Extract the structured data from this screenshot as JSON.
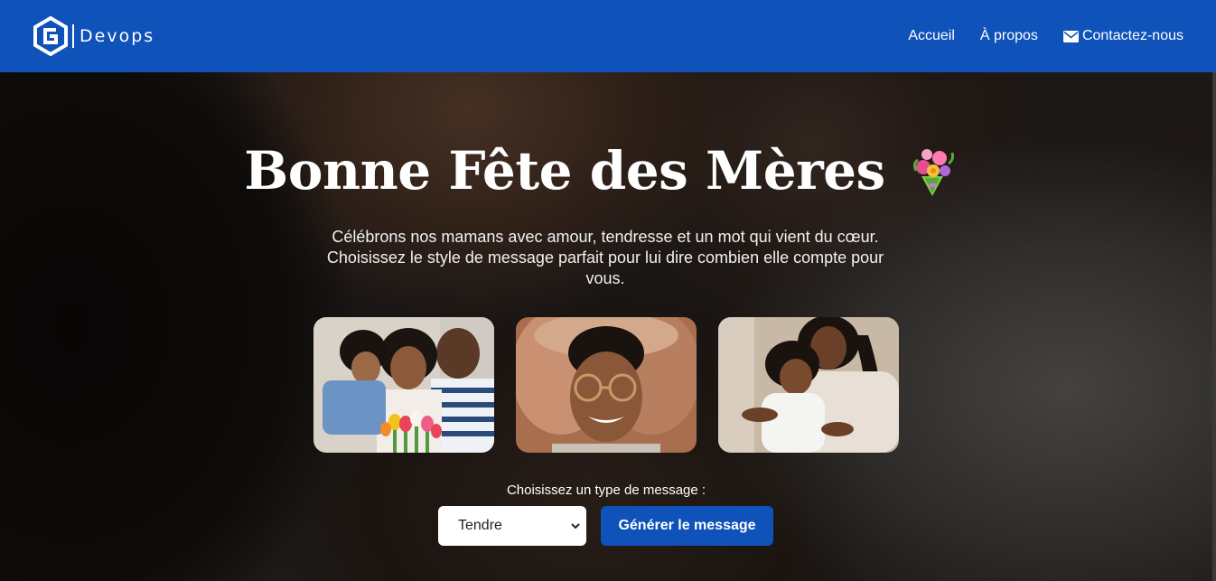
{
  "navbar": {
    "brand_name": "Devops",
    "links": [
      {
        "label": "Accueil"
      },
      {
        "label": "À propos"
      },
      {
        "label": "Contactez-nous",
        "icon": "mail-icon"
      }
    ],
    "bg_color": "#0f52ba"
  },
  "hero": {
    "title": "Bonne Fête des Mères",
    "title_icon": "bouquet-icon",
    "subtitle": "Célébrons nos mamans avec amour, tendresse et un mot qui vient du cœur. Choisissez le style de message parfait pour lui dire combien elle compte pour vous."
  },
  "photos": [
    {
      "name": "family-with-tulips-photo"
    },
    {
      "name": "woman-heart-hands-photo"
    },
    {
      "name": "mother-child-hug-photo"
    }
  ],
  "form": {
    "label": "Choisissez un type de message :",
    "selected_type": "Tendre",
    "button_label": "Générer le message",
    "accent_color": "#0f52ba"
  }
}
